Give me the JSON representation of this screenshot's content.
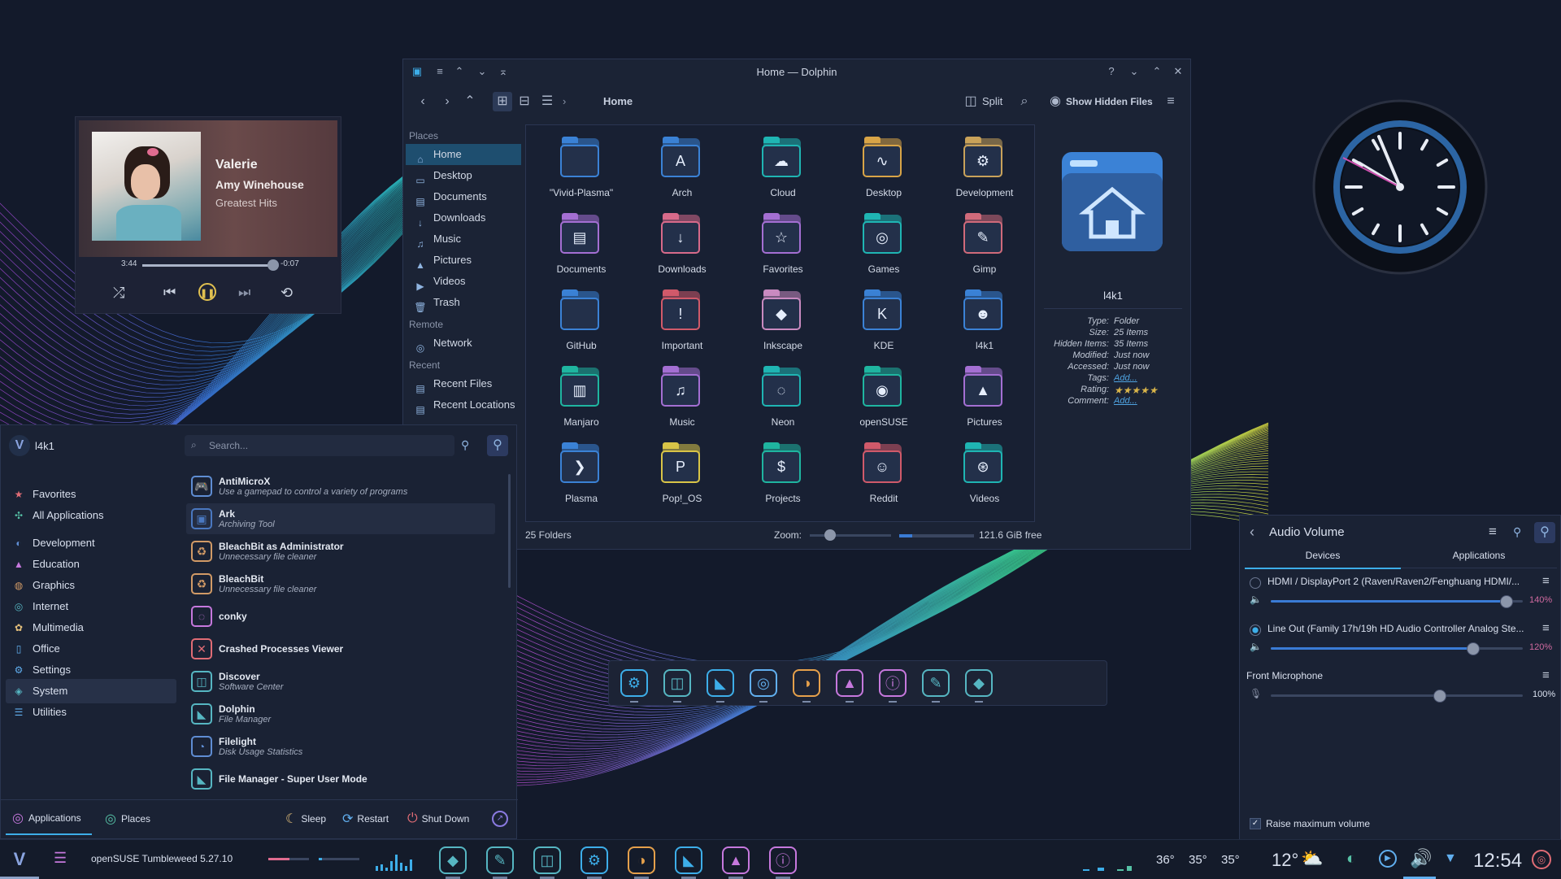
{
  "dolphin": {
    "window_title": "Home — Dolphin",
    "breadcrumb": "Home",
    "split_label": "Split",
    "show_hidden_label": "Show Hidden Files",
    "places_header": "Places",
    "places": [
      "Home",
      "Desktop",
      "Documents",
      "Downloads",
      "Music",
      "Pictures",
      "Videos",
      "Trash"
    ],
    "remote_header": "Remote",
    "remote": [
      "Network"
    ],
    "recent_header": "Recent",
    "recent": [
      "Recent Files",
      "Recent Locations"
    ],
    "folders": [
      {
        "name": "\"Vivid-Plasma\"",
        "color": "#3b82d6",
        "glyph": ""
      },
      {
        "name": "Arch",
        "color": "#3b82d6",
        "glyph": "A"
      },
      {
        "name": "Cloud",
        "color": "#1fb5b3",
        "glyph": "☁"
      },
      {
        "name": "Desktop",
        "color": "#d8a447",
        "glyph": "∿"
      },
      {
        "name": "Development",
        "color": "#c9a25a",
        "glyph": "⚙"
      },
      {
        "name": "Documents",
        "color": "#a46fd3",
        "glyph": "▤"
      },
      {
        "name": "Downloads",
        "color": "#d76a8a",
        "glyph": "↓"
      },
      {
        "name": "Favorites",
        "color": "#a46fd3",
        "glyph": "☆"
      },
      {
        "name": "Games",
        "color": "#1fb5b3",
        "glyph": "◎"
      },
      {
        "name": "Gimp",
        "color": "#d06a7a",
        "glyph": "✎"
      },
      {
        "name": "GitHub",
        "color": "#3b82d6",
        "glyph": ""
      },
      {
        "name": "Important",
        "color": "#d05a6a",
        "glyph": "!"
      },
      {
        "name": "Inkscape",
        "color": "#c98ac0",
        "glyph": "◆"
      },
      {
        "name": "KDE",
        "color": "#3b82d6",
        "glyph": "K"
      },
      {
        "name": "l4k1",
        "color": "#3b82d6",
        "glyph": "☻"
      },
      {
        "name": "Manjaro",
        "color": "#1fb5a0",
        "glyph": "▥"
      },
      {
        "name": "Music",
        "color": "#a46fd3",
        "glyph": "♫"
      },
      {
        "name": "Neon",
        "color": "#1fb5b3",
        "glyph": "◌"
      },
      {
        "name": "openSUSE",
        "color": "#1fb5a0",
        "glyph": "◉"
      },
      {
        "name": "Pictures",
        "color": "#a46fd3",
        "glyph": "▲"
      },
      {
        "name": "Plasma",
        "color": "#3b82d6",
        "glyph": "❯"
      },
      {
        "name": "Pop!_OS",
        "color": "#d8c447",
        "glyph": "P"
      },
      {
        "name": "Projects",
        "color": "#1fb5a0",
        "glyph": "$"
      },
      {
        "name": "Reddit",
        "color": "#d05a6a",
        "glyph": "☺"
      },
      {
        "name": "Videos",
        "color": "#1fb5b3",
        "glyph": "⊛"
      }
    ],
    "info": {
      "name": "l4k1",
      "rows": [
        {
          "k": "Type:",
          "v": "Folder"
        },
        {
          "k": "Size:",
          "v": "25 Items"
        },
        {
          "k": "Hidden Items:",
          "v": "35 Items"
        },
        {
          "k": "Modified:",
          "v": "Just now"
        },
        {
          "k": "Accessed:",
          "v": "Just now"
        },
        {
          "k": "Tags:",
          "v": "Add..."
        },
        {
          "k": "Rating:",
          "v": ""
        },
        {
          "k": "Comment:",
          "v": "Add..."
        }
      ],
      "rating": 5
    },
    "status_count": "25 Folders",
    "zoom_label": "Zoom:",
    "free_space": "121.6 GiB free"
  },
  "player": {
    "track": "Valerie",
    "artist": "Amy Winehouse",
    "album": "Greatest Hits",
    "elapsed": "3:44",
    "remaining": "-0:07",
    "progress": 0.96
  },
  "launcher": {
    "user": "l4k1",
    "search_placeholder": "Search...",
    "categories": [
      {
        "label": "Favorites",
        "color": "#e06c75",
        "glyph": "★"
      },
      {
        "label": "All Applications",
        "color": "#56c2a6",
        "glyph": "✣"
      },
      {
        "label": "Development",
        "color": "#5f8dd3",
        "glyph": "◐"
      },
      {
        "label": "Education",
        "color": "#c678dd",
        "glyph": "▲"
      },
      {
        "label": "Graphics",
        "color": "#d19a66",
        "glyph": "◍"
      },
      {
        "label": "Internet",
        "color": "#56b6c2",
        "glyph": "◎"
      },
      {
        "label": "Multimedia",
        "color": "#e5c07b",
        "glyph": "✿"
      },
      {
        "label": "Office",
        "color": "#61afef",
        "glyph": "▯"
      },
      {
        "label": "Settings",
        "color": "#61afef",
        "glyph": "⚙"
      },
      {
        "label": "System",
        "color": "#56b6c2",
        "glyph": "◈"
      },
      {
        "label": "Utilities",
        "color": "#61afef",
        "glyph": "☰"
      }
    ],
    "apps": [
      {
        "name": "AntiMicroX",
        "desc": "Use a gamepad to control a variety of programs",
        "color": "#5f8dd3",
        "glyph": "🎮"
      },
      {
        "name": "Ark",
        "desc": "Archiving Tool",
        "color": "#4a78c0",
        "glyph": "▣"
      },
      {
        "name": "BleachBit as Administrator",
        "desc": "Unnecessary file cleaner",
        "color": "#d19a66",
        "glyph": "♻"
      },
      {
        "name": "BleachBit",
        "desc": "Unnecessary file cleaner",
        "color": "#d19a66",
        "glyph": "♻"
      },
      {
        "name": "conky",
        "desc": "",
        "color": "#c678dd",
        "glyph": "◌"
      },
      {
        "name": "Crashed Processes Viewer",
        "desc": "",
        "color": "#e06c75",
        "glyph": "✕"
      },
      {
        "name": "Discover",
        "desc": "Software Center",
        "color": "#56b6c2",
        "glyph": "◫"
      },
      {
        "name": "Dolphin",
        "desc": "File Manager",
        "color": "#56b6c2",
        "glyph": "◣"
      },
      {
        "name": "Filelight",
        "desc": "Disk Usage Statistics",
        "color": "#5f8dd3",
        "glyph": "◔"
      },
      {
        "name": "File Manager - Super User Mode",
        "desc": "",
        "color": "#56b6c2",
        "glyph": "◣"
      }
    ],
    "footer": {
      "applications": "Applications",
      "places": "Places",
      "sleep": "Sleep",
      "restart": "Restart",
      "shutdown": "Shut Down"
    }
  },
  "audio": {
    "title": "Audio Volume",
    "tabs": [
      "Devices",
      "Applications"
    ],
    "devices": [
      {
        "name": "HDMI / DisplayPort 2 (Raven/Raven2/Fenghuang HDMI/...",
        "volume": "140%",
        "level": 1.4,
        "selected": false
      },
      {
        "name": "Line Out (Family 17h/19h HD Audio Controller Analog Ste...",
        "volume": "120%",
        "level": 1.2,
        "selected": true
      }
    ],
    "mic": {
      "name": "Front Microphone",
      "volume": "100%",
      "level": 1.0
    },
    "raise_max": "Raise maximum volume"
  },
  "taskbar": {
    "os_label": "openSUSE Tumbleweed 5.27.10",
    "temps": [
      "36°",
      "35°",
      "35°"
    ],
    "weather": "12°",
    "time": "12:54"
  },
  "colors": {
    "accent": "#3daee9",
    "panel": "#1a2234",
    "selection": "#1e4e6f"
  }
}
